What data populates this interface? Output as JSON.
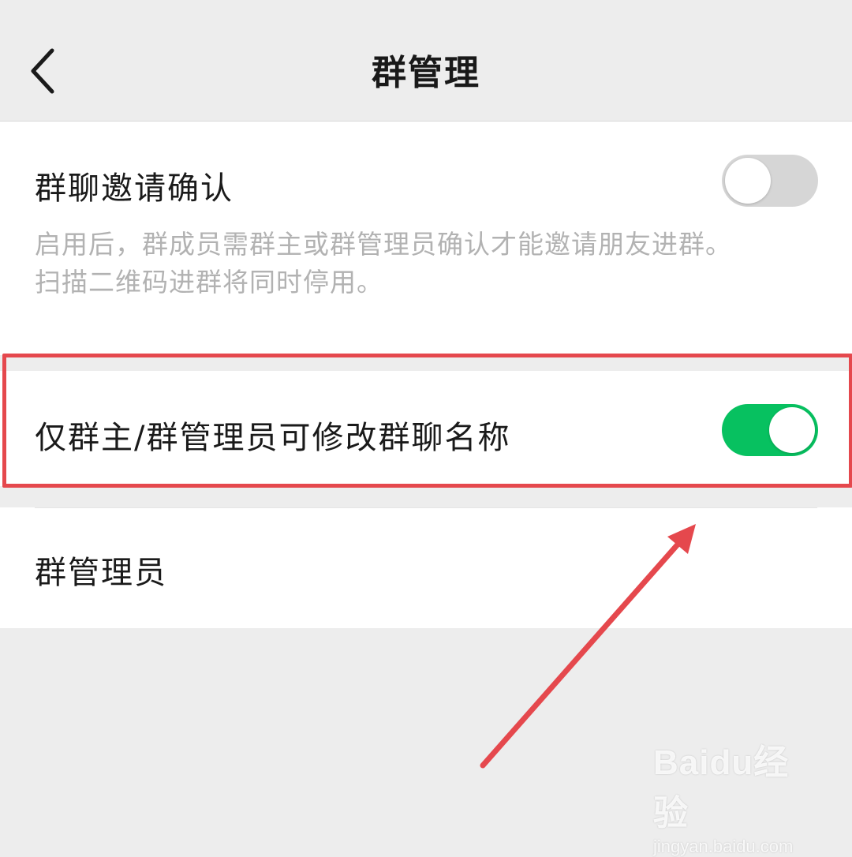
{
  "nav": {
    "title": "群管理"
  },
  "settings": {
    "invite_confirm": {
      "label": "群聊邀请确认",
      "description_line1": "启用后，群成员需群主或群管理员确认才能邀请朋友进群。",
      "description_line2": "扫描二维码进群将同时停用。",
      "enabled": false
    },
    "owner_admin_rename": {
      "label": "仅群主/群管理员可修改群聊名称",
      "enabled": true
    },
    "admins": {
      "label": "群管理员"
    }
  },
  "colors": {
    "accent_green": "#07c160",
    "annotation_red": "#e5484d",
    "toggle_off": "#d6d6d6"
  },
  "watermark": {
    "logo": "Baidu经验",
    "url": "jingyan.baidu.com"
  }
}
